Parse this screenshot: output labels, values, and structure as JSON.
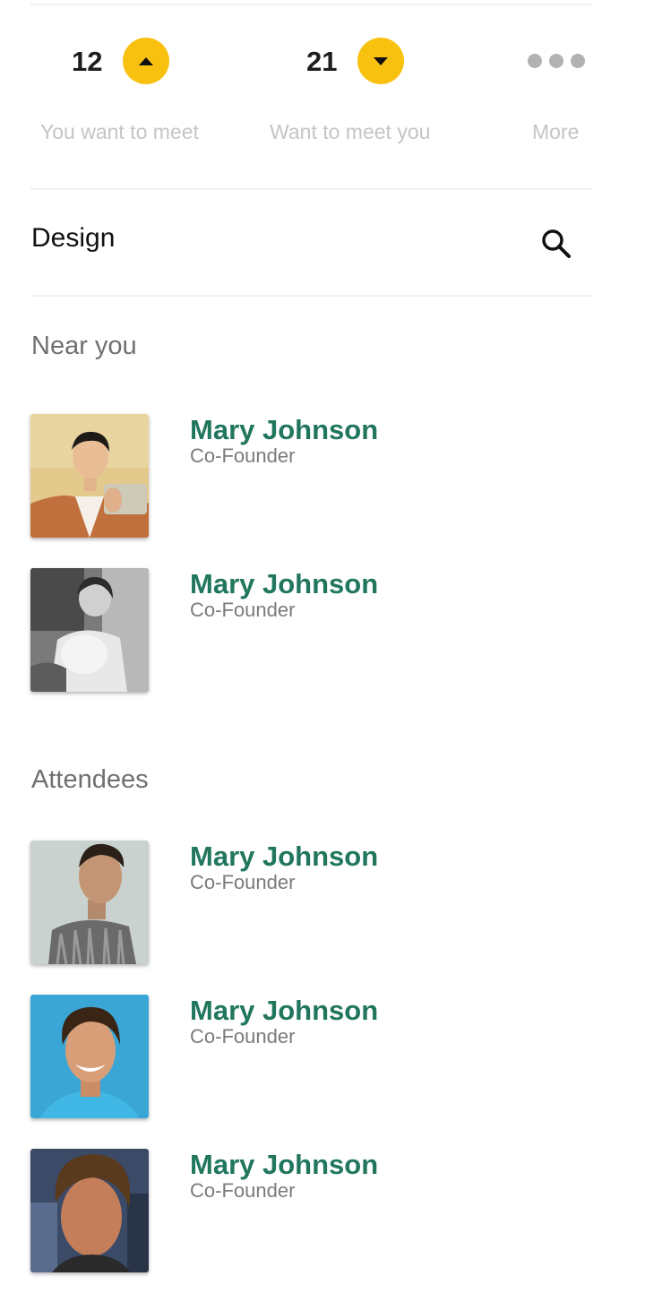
{
  "stats": {
    "you_want_to_meet": {
      "count": "12",
      "label": "You want to meet"
    },
    "want_to_meet_you": {
      "count": "21",
      "label": "Want to meet you"
    },
    "more": {
      "label": "More"
    }
  },
  "search": {
    "title": "Design"
  },
  "sections": {
    "near_you": {
      "title": "Near you",
      "people": [
        {
          "name": "Mary Johnson",
          "role": "Co-Founder"
        },
        {
          "name": "Mary Johnson",
          "role": "Co-Founder"
        }
      ]
    },
    "attendees": {
      "title": "Attendees",
      "people": [
        {
          "name": "Mary Johnson",
          "role": "Co-Founder"
        },
        {
          "name": "Mary Johnson",
          "role": "Co-Founder"
        },
        {
          "name": "Mary Johnson",
          "role": "Co-Founder"
        }
      ]
    }
  },
  "colors": {
    "accent_yellow": "#f9c10f",
    "name_green": "#21765e",
    "section_gray": "#707070",
    "label_gray": "#c5c5c5"
  }
}
